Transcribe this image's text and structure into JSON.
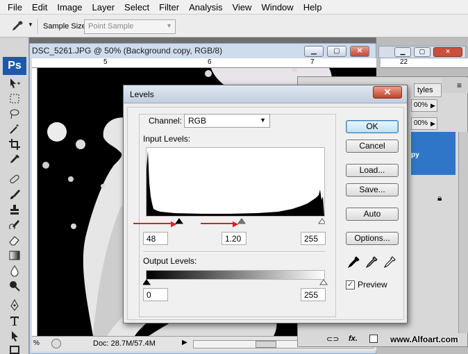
{
  "menu": [
    "File",
    "Edit",
    "Image",
    "Layer",
    "Select",
    "Filter",
    "Analysis",
    "View",
    "Window",
    "Help"
  ],
  "options_bar": {
    "tool_icon": "eyedropper-icon",
    "sample_size_label": "Sample Size:",
    "sample_size_value": "Point Sample"
  },
  "toolbox": {
    "logo": "Ps",
    "tools": [
      "move-icon",
      "marquee-icon",
      "lasso-icon",
      "magic-wand-icon",
      "crop-icon",
      "eyedropper-icon",
      "healing-brush-icon",
      "brush-icon",
      "clone-stamp-icon",
      "history-brush-icon",
      "eraser-icon",
      "gradient-icon",
      "blur-icon",
      "dodge-icon",
      "pen-icon",
      "type-icon",
      "path-selection-icon",
      "shape-icon"
    ]
  },
  "document": {
    "title": "DSC_5261.JPG @ 50% (Background copy, RGB/8)",
    "ruler_labels": [
      "5",
      "6",
      "7",
      "22"
    ],
    "status_zoom": "%",
    "doc_info": "Doc: 28.7M/57.4M"
  },
  "panels": {
    "styles_tab": "tyles",
    "opacity": "00%",
    "fill": "00%",
    "layer_name": "py",
    "watermark": "www.Alfoart.com",
    "fx_label": "fx."
  },
  "levels": {
    "title": "Levels",
    "channel_label": "Channel:",
    "channel_value": "RGB",
    "input_label": "Input Levels:",
    "input_black": "48",
    "input_gamma": "1.20",
    "input_white": "255",
    "output_label": "Output Levels:",
    "output_black": "0",
    "output_white": "255",
    "buttons": {
      "ok": "OK",
      "cancel": "Cancel",
      "load": "Load...",
      "save": "Save...",
      "auto": "Auto",
      "options": "Options..."
    },
    "preview_label": "Preview",
    "preview_checked": true,
    "colors": {
      "accent": "#3c7fb1",
      "annotation_arrow": "#e02020",
      "close": "#c24128"
    }
  }
}
